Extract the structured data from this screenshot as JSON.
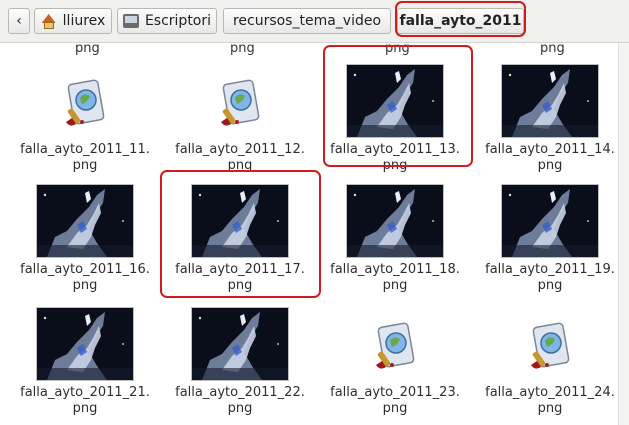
{
  "pathbar": {
    "back_symbol": "‹",
    "crumbs": [
      "lliurex",
      "Escriptori",
      "recursos_tema_video"
    ],
    "current": "falla_ayto_2011"
  },
  "files": {
    "previous_row_stub": [
      "png",
      "png",
      "png",
      "png"
    ],
    "items": [
      {
        "name": "falla_ayto_2011_11.",
        "ext": "png",
        "preview": "generic-image-icon"
      },
      {
        "name": "falla_ayto_2011_12.",
        "ext": "png",
        "preview": "generic-image-icon"
      },
      {
        "name": "falla_ayto_2011_13.",
        "ext": "png",
        "preview": "video-frame-thumbnail"
      },
      {
        "name": "falla_ayto_2011_14.",
        "ext": "png",
        "preview": "video-frame-thumbnail"
      },
      {
        "name": "falla_ayto_2011_16.",
        "ext": "png",
        "preview": "video-frame-thumbnail"
      },
      {
        "name": "falla_ayto_2011_17.",
        "ext": "png",
        "preview": "video-frame-thumbnail"
      },
      {
        "name": "falla_ayto_2011_18.",
        "ext": "png",
        "preview": "video-frame-thumbnail"
      },
      {
        "name": "falla_ayto_2011_19.",
        "ext": "png",
        "preview": "video-frame-thumbnail"
      },
      {
        "name": "falla_ayto_2011_21.",
        "ext": "png",
        "preview": "video-frame-thumbnail"
      },
      {
        "name": "falla_ayto_2011_22.",
        "ext": "png",
        "preview": "video-frame-thumbnail"
      },
      {
        "name": "falla_ayto_2011_23.",
        "ext": "png",
        "preview": "generic-image-icon"
      },
      {
        "name": "falla_ayto_2011_24.",
        "ext": "png",
        "preview": "generic-image-icon"
      }
    ]
  },
  "colors": {
    "highlight": "#d21b1b",
    "thumbnail_background": "#0b0f1c"
  }
}
